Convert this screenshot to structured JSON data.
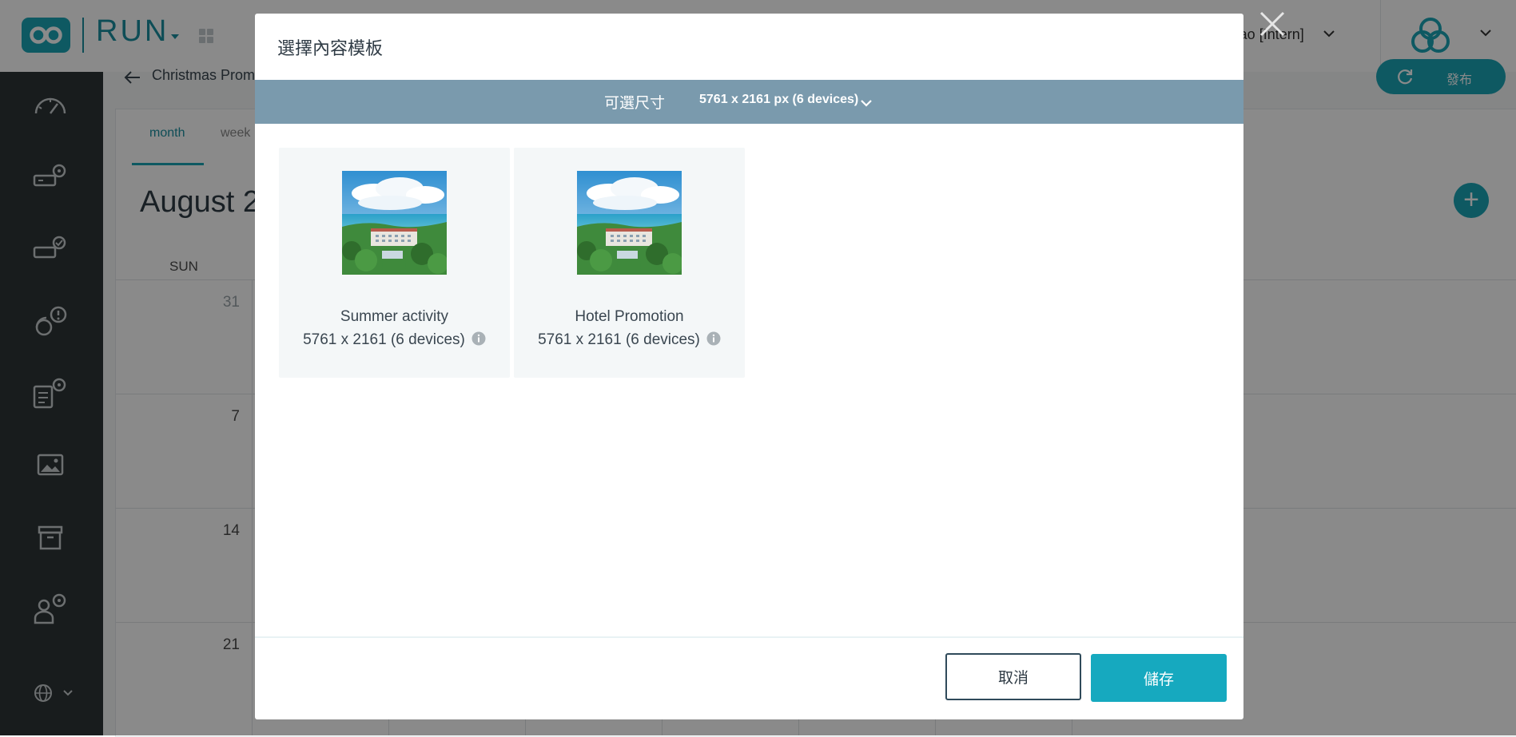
{
  "app": {
    "brand": "RUN",
    "user_name": "Yao [Intern]"
  },
  "header": {
    "breadcrumb": "Christmas Prom",
    "publish_label": "發布"
  },
  "calendar": {
    "tabs": [
      {
        "label": "month"
      },
      {
        "label": "week"
      }
    ],
    "month_title": "August 20",
    "day_of_week": "SUN",
    "day_numbers": [
      "31",
      "7",
      "14",
      "21"
    ]
  },
  "modal": {
    "title": "選擇內容模板",
    "size_label": "可選尺寸",
    "size_value": "5761 x 2161 px (6 devices)",
    "templates": [
      {
        "name": "Summer activity",
        "size": "5761 x 2161 (6 devices)"
      },
      {
        "name": "Hotel Promotion",
        "size": "5761 x 2161 (6 devices)"
      }
    ],
    "cancel_label": "取消",
    "save_label": "儲存"
  },
  "colors": {
    "accent": "#1aa4b6",
    "sidebar": "#2d3436",
    "size_bar": "#7a9aad",
    "overlay": "rgba(0,0,0,0.46)"
  },
  "icons": [
    "logo-icon",
    "apps-grid-icon",
    "chevron-down-icon",
    "org-logo-icon",
    "dashboard-icon",
    "device-settings-icon",
    "device-check-icon",
    "alert-icon",
    "schedule-settings-icon",
    "image-icon",
    "archive-icon",
    "user-settings-icon",
    "globe-icon",
    "back-arrow-icon",
    "refresh-icon",
    "add-icon",
    "info-icon",
    "close-icon"
  ]
}
